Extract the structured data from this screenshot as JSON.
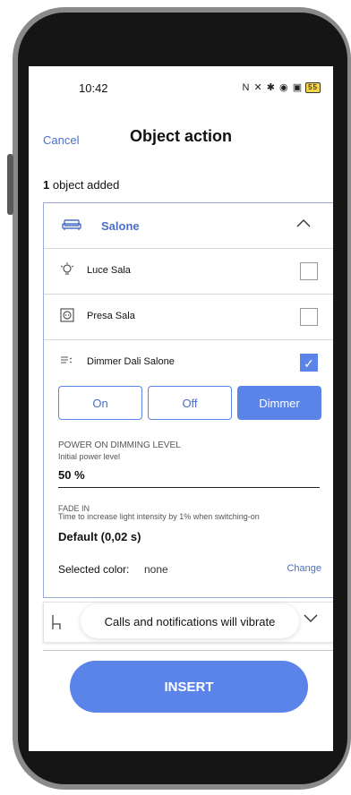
{
  "status_bar": {
    "time": "10:42",
    "icons": "N ✕ ✱ ◉ ▣",
    "battery": "55"
  },
  "header": {
    "cancel_label": "Cancel",
    "title": "Object action"
  },
  "summary": {
    "count": "1",
    "suffix": " object added"
  },
  "room": {
    "label": "Salone",
    "icon": "sofa-icon",
    "expanded": true
  },
  "items": [
    {
      "label": "Luce Sala",
      "icon": "lightbulb-icon",
      "checked": false
    },
    {
      "label": "Presa Sala",
      "icon": "socket-icon",
      "checked": false
    },
    {
      "label": "Dimmer Dali Salone",
      "icon": "dimmer-icon",
      "checked": true
    }
  ],
  "modes": {
    "options": [
      "On",
      "Off",
      "Dimmer"
    ],
    "selected": "Dimmer"
  },
  "power_on": {
    "label": "POWER ON DIMMING LEVEL",
    "sub": "Initial power level",
    "value": "50 %"
  },
  "fade_in": {
    "label": "FADE IN",
    "sub": "Time to increase light intensity by 1% when switching-on",
    "value": "Default (0,02 s)"
  },
  "color": {
    "label": "Selected color:",
    "value": "none",
    "change_label": "Change"
  },
  "toast": {
    "text": "Calls and notifications will vibrate"
  },
  "insert_label": "INSERT",
  "colors": {
    "accent": "#5b84e8",
    "link": "#4b6fc8"
  }
}
